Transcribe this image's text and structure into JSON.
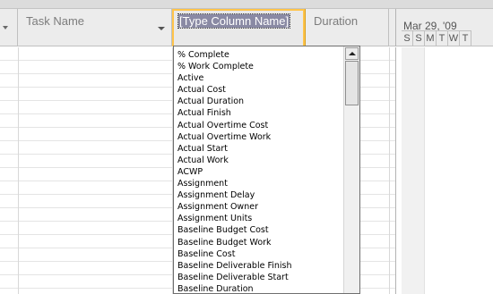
{
  "header": {
    "task_name": "Task Name",
    "type_column": "[Type Column Name]",
    "duration": "Duration"
  },
  "gantt": {
    "week": "Mar 29, '09",
    "days": [
      "S",
      "S",
      "M",
      "T",
      "W",
      "T"
    ]
  },
  "field_list": [
    "% Complete",
    "% Work Complete",
    "Active",
    "Actual Cost",
    "Actual Duration",
    "Actual Finish",
    "Actual Overtime Cost",
    "Actual Overtime Work",
    "Actual Start",
    "Actual Work",
    "ACWP",
    "Assignment",
    "Assignment Delay",
    "Assignment Owner",
    "Assignment Units",
    "Baseline Budget Cost",
    "Baseline Budget Work",
    "Baseline Cost",
    "Baseline Deliverable Finish",
    "Baseline Deliverable Start",
    "Baseline Duration"
  ]
}
